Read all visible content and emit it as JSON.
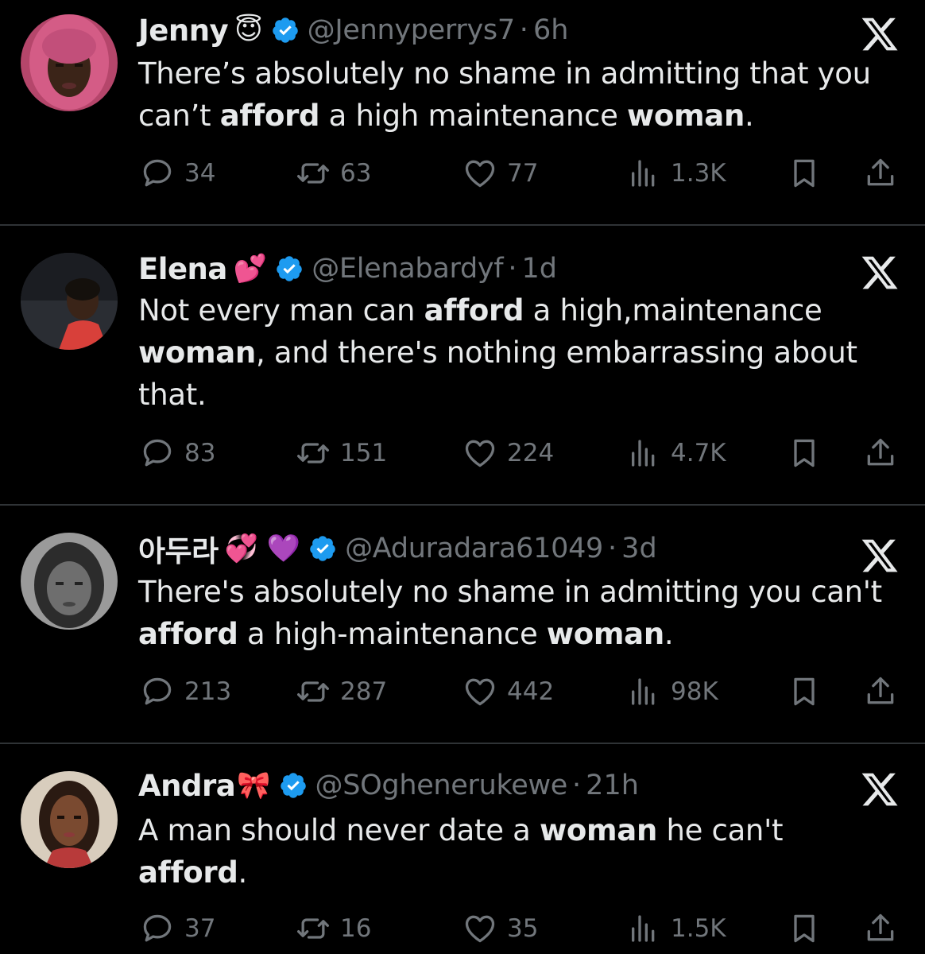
{
  "tweets": [
    {
      "name": "Jenny",
      "emoji": "😇",
      "handle": "@Jennyperrys7",
      "time": "6h",
      "text_parts": [
        {
          "t": "There’s absolutely no shame in admitting that you can’t ",
          "b": false
        },
        {
          "t": "afford",
          "b": true
        },
        {
          "t": " a high maintenance ",
          "b": false
        },
        {
          "t": "woman",
          "b": true
        },
        {
          "t": ".",
          "b": false
        }
      ],
      "replies": "34",
      "reposts": "63",
      "likes": "77",
      "views": "1.3K"
    },
    {
      "name": "Elena",
      "emoji": "💕",
      "handle": "@Elenabardyf",
      "time": "1d",
      "text_parts": [
        {
          "t": "Not every man can ",
          "b": false
        },
        {
          "t": "afford",
          "b": true
        },
        {
          "t": " a high,maintenance ",
          "b": false
        },
        {
          "t": "woman",
          "b": true
        },
        {
          "t": ", and there's nothing embarrassing about that.",
          "b": false
        }
      ],
      "replies": "83",
      "reposts": "151",
      "likes": "224",
      "views": "4.7K"
    },
    {
      "name": "아두라",
      "emoji": "💞 💜",
      "handle": "@Aduradara61049",
      "time": "3d",
      "text_parts": [
        {
          "t": "There's absolutely no shame in admitting you can't ",
          "b": false
        },
        {
          "t": "afford",
          "b": true
        },
        {
          "t": " a high-maintenance ",
          "b": false
        },
        {
          "t": "woman",
          "b": true
        },
        {
          "t": ".",
          "b": false
        }
      ],
      "replies": "213",
      "reposts": "287",
      "likes": "442",
      "views": "98K"
    },
    {
      "name": "Andra",
      "emoji": "🎀",
      "handle": "@SOgheneruk‌ewe",
      "time": "21h",
      "text_parts": [
        {
          "t": "A man should never date a ",
          "b": false
        },
        {
          "t": "woman",
          "b": true
        },
        {
          "t": " he can't ",
          "b": false
        },
        {
          "t": "afford",
          "b": true
        },
        {
          "t": ".",
          "b": false
        }
      ],
      "replies": "37",
      "reposts": "16",
      "likes": "35",
      "views": "1.5K"
    }
  ],
  "colors": {
    "background": "#000000",
    "text": "#e7e9ea",
    "muted": "#71767b",
    "verified": "#1d9bf0",
    "divider": "#2f3336"
  },
  "icons": {
    "reply": "speech-bubble-icon",
    "repost": "repost-arrows-icon",
    "like": "heart-icon",
    "views": "bar-chart-icon",
    "bookmark": "bookmark-icon",
    "share": "share-upload-icon",
    "x": "x-logo-icon",
    "verified": "verified-badge-icon"
  }
}
